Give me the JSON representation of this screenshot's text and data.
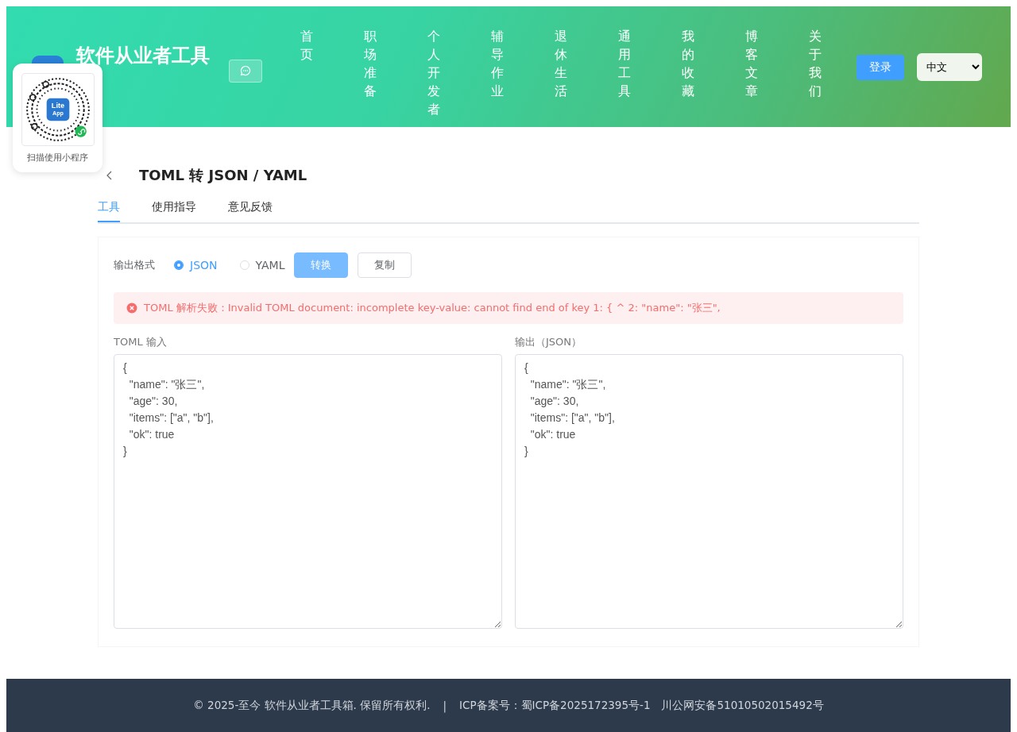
{
  "header": {
    "site_title": "软件从业者工具",
    "nav": [
      {
        "label": "首页"
      },
      {
        "label": "职场准备"
      },
      {
        "label": "个人开发者"
      },
      {
        "label": "辅导作业"
      },
      {
        "label": "退休生活"
      },
      {
        "label": "通用工具"
      },
      {
        "label": "我的收藏"
      },
      {
        "label": "博客文章"
      },
      {
        "label": "关于我们"
      }
    ],
    "login_button": "登录",
    "language": "中文"
  },
  "qr_popup": {
    "logo_lines": [
      "Lite",
      "App"
    ],
    "caption": "扫描使用小程序"
  },
  "page": {
    "title": "TOML 转 JSON / YAML",
    "tabs": [
      {
        "label": "工具",
        "selected": true
      },
      {
        "label": "使用指导",
        "selected": false
      },
      {
        "label": "意见反馈",
        "selected": false
      }
    ],
    "format_label": "输出格式",
    "formats": [
      {
        "label": "JSON",
        "selected": true
      },
      {
        "label": "YAML",
        "selected": false
      }
    ],
    "convert_button": "转换",
    "copy_button": "复制",
    "error": "TOML 解析失败：Invalid TOML document: incomplete key-value: cannot find end of key 1: { ^ 2: \"name\": \"张三\",",
    "input_label": "TOML 输入",
    "input_value": "{\n  \"name\": \"张三\",\n  \"age\": 30,\n  \"items\": [\"a\", \"b\"],\n  \"ok\": true\n}",
    "output_label": "输出（JSON）",
    "output_value": "{\n  \"name\": \"张三\",\n  \"age\": 30,\n  \"items\": [\"a\", \"b\"],\n  \"ok\": true\n}"
  },
  "footer": {
    "copyright": "© 2025-至今 软件从业者工具箱. 保留所有权利.",
    "separator": "|",
    "icp": "ICP备案号：蜀ICP备2025172395号-1",
    "police": "川公网安备51010502015492号"
  }
}
